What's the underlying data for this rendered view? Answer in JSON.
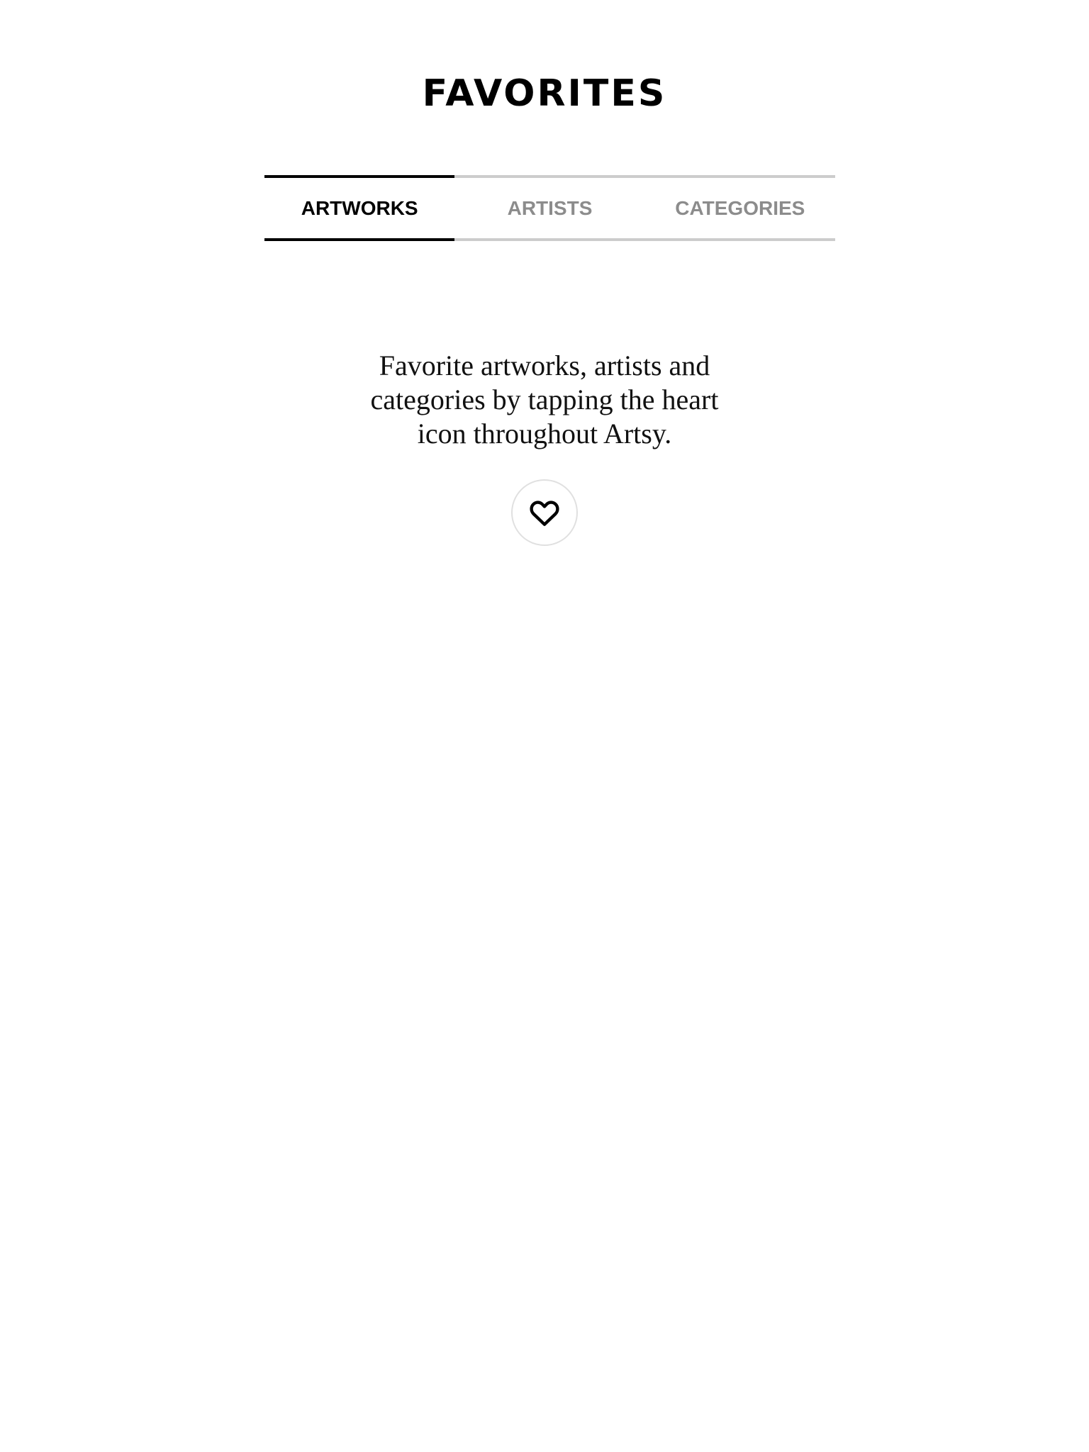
{
  "header": {
    "title": "FAVORITES"
  },
  "tabs": [
    {
      "label": "ARTWORKS",
      "active": true
    },
    {
      "label": "ARTISTS",
      "active": false
    },
    {
      "label": "CATEGORIES",
      "active": false
    }
  ],
  "empty_state": {
    "message": "Favorite artworks, artists and categories by tapping the heart icon throughout Artsy.",
    "icon": "heart-icon"
  },
  "colors": {
    "active_tab": "#000000",
    "inactive_tab": "#8c8c8c",
    "inactive_border": "#cccccc",
    "circle_border": "#e0e0e0"
  }
}
